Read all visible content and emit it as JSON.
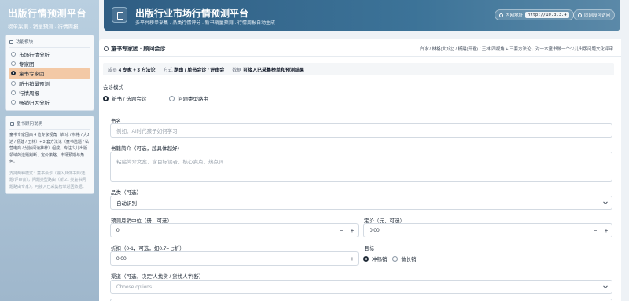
{
  "sidebar": {
    "title": "出版行情预测平台",
    "subtitle": "榜单采集 · 销量预测 · 行情周报",
    "nav_header": "功能模块",
    "items": [
      {
        "label": "市场行情分析",
        "active": false
      },
      {
        "label": "专家团",
        "active": false
      },
      {
        "label": "童书专家团",
        "active": true
      },
      {
        "label": "新书销量预测",
        "active": false
      },
      {
        "label": "行情周报",
        "active": false
      },
      {
        "label": "畅销归因分析",
        "active": false
      }
    ],
    "info_header": "童书顾问说明",
    "info_text": "童书专家团由 4 位专家视角（白冰 / 林格 / 大J 达 / 杨建 / 王林）+ 3 套方法论（童书选题 / 私营电商 / 分龄阅读推荐）组成。专注少儿出版领域的选题判断、定价策略、市场预期与角色。",
    "info_text_faint": "支持两种模式：童书会诊（输入具体书目/选题/评审会），问题类型路由（新 21 类童书问题路由专家）。可接入已采集榜单返回数据。"
  },
  "header": {
    "title": "出版行业市场行情预测平台",
    "subtitle": "多平台榜单采集 · 品类行情评分 · 新书销量预测 · 行情周报自动生成",
    "chip_address_label": "内网地址",
    "chip_address_value": "http://10.3.3.4",
    "chip_right_label": "同网段可访问"
  },
  "panel": {
    "title": "童书专家团 · 顾问会诊",
    "description": "白冰 / 林格(大J达) / 杨建(开卷) / 王林 四视角 + 三套方法论，对一本童书做一个少儿出版问题文化评审",
    "summary": [
      {
        "key": "成员",
        "value": "4 专家 + 3 方法论"
      },
      {
        "key": "方式",
        "value": "路由 / 单书会诊 / 评审会"
      },
      {
        "key": "数据",
        "value": "可接入已采集榜单和预测结果"
      }
    ]
  },
  "form": {
    "mode_label": "会诊模式",
    "mode_options": [
      {
        "label": "新书 / 选题会诊",
        "selected": true
      },
      {
        "label": "问题类型路由",
        "selected": false
      }
    ],
    "title_label": "书名",
    "title_placeholder": "例如：AI时代孩子如何学习",
    "intro_label": "书籍简介（可选，越具体越好）",
    "intro_placeholder": "粘贴简介文案、含目标读者、核心卖点、热点词……",
    "category_label": "品类（可选）",
    "category_value": "自动识别",
    "monthly_label": "预测月销中位（册，可选）",
    "monthly_value": "0",
    "price_label": "定价（元，可选）",
    "price_value": "0.00",
    "discount_label": "折扣（0-1，可选，如0.7=七折）",
    "discount_value": "0.00",
    "goal_label": "目标",
    "goal_options": [
      {
        "label": "冲畅销",
        "selected": true
      },
      {
        "label": "做长销",
        "selected": false
      }
    ],
    "channel_label": "渠道（可选，决定'人找货 / 货找人'判断）",
    "channel_placeholder": "Choose options"
  }
}
